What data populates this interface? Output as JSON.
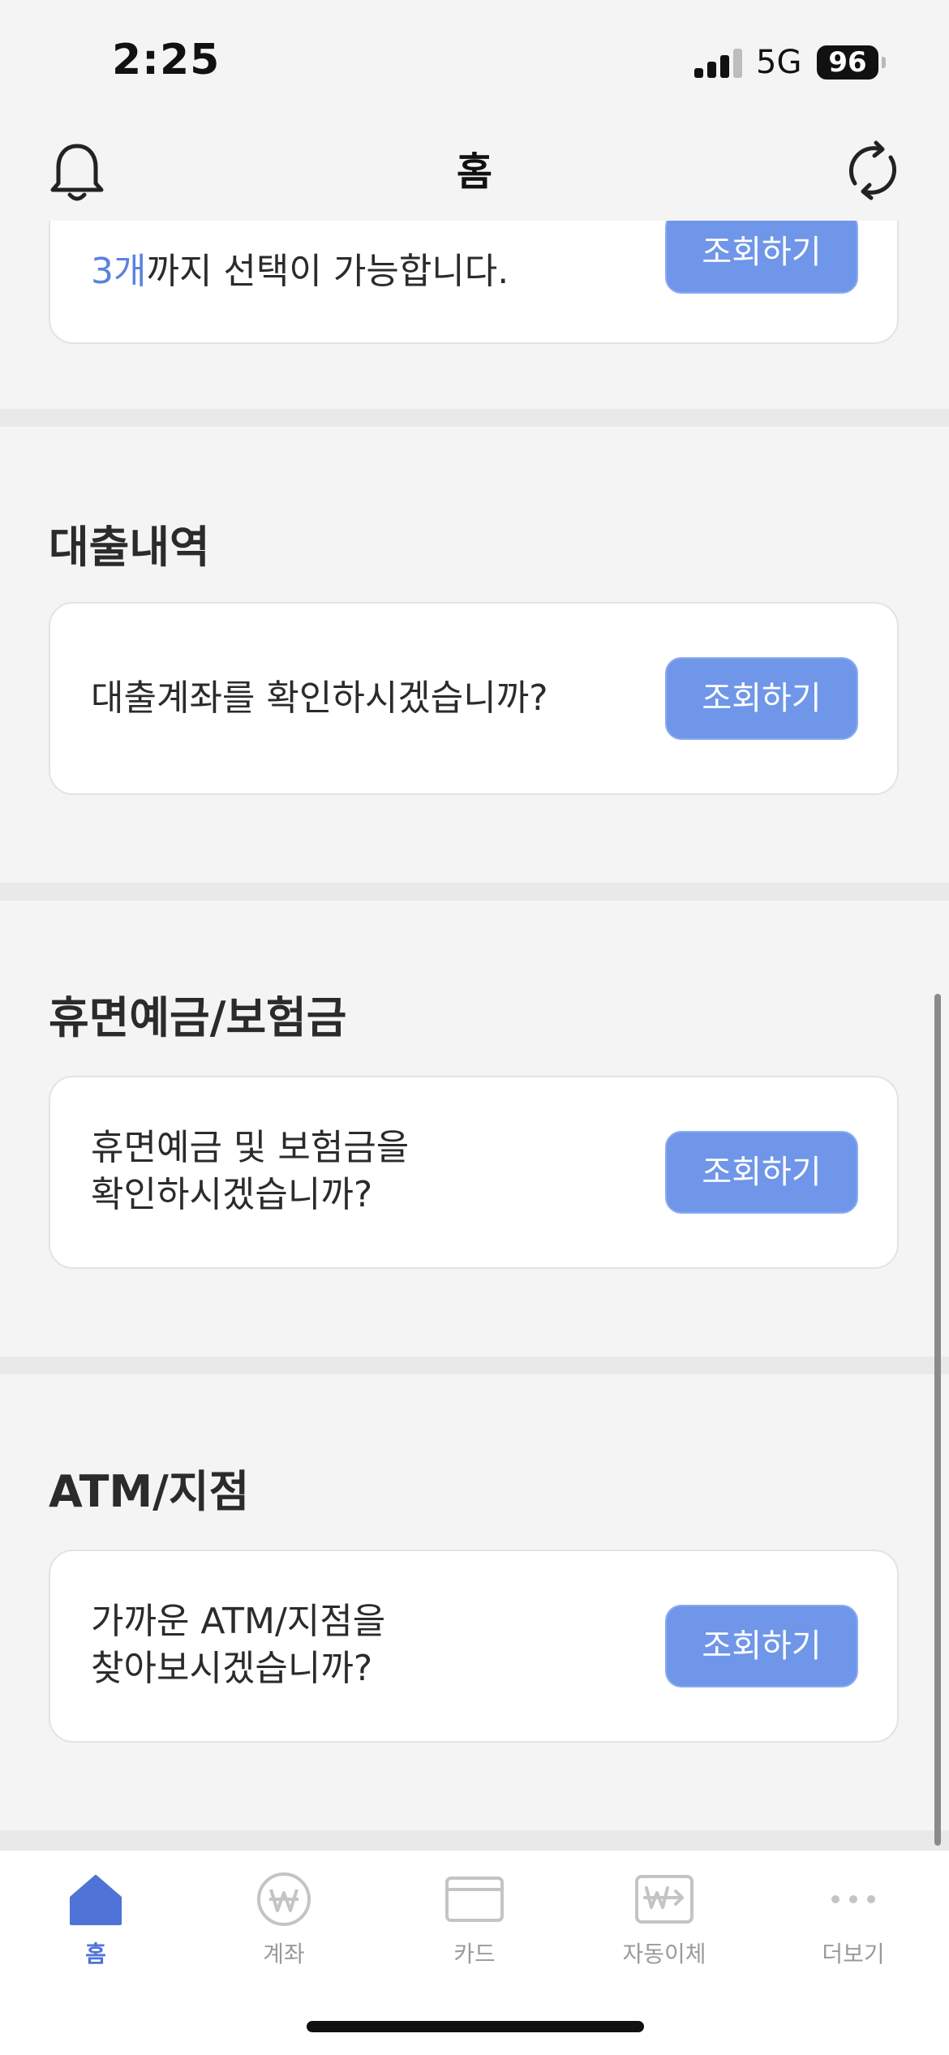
{
  "status_bar": {
    "time": "2:25",
    "network": "5G",
    "battery": "96"
  },
  "header": {
    "title": "홈"
  },
  "sections": {
    "top_card": {
      "highlight": "3개",
      "text": "까지 선택이 가능합니다.",
      "button": "조회하기"
    },
    "loans": {
      "title": "대출내역",
      "text": "대출계좌를 확인하시겠습니까?",
      "button": "조회하기"
    },
    "dormant": {
      "title": "휴면예금/보험금",
      "text_line1": "휴면예금 및 보험금을",
      "text_line2": "확인하시겠습니까?",
      "button": "조회하기"
    },
    "atm": {
      "title": "ATM/지점",
      "text_line1": "가까운 ATM/지점을",
      "text_line2": "찾아보시겠습니까?",
      "button": "조회하기"
    }
  },
  "tabbar": {
    "items": [
      {
        "label": "홈",
        "icon": "home-icon",
        "active": true
      },
      {
        "label": "계좌",
        "icon": "won-coin-icon",
        "active": false
      },
      {
        "label": "카드",
        "icon": "card-icon",
        "active": false
      },
      {
        "label": "자동이체",
        "icon": "auto-transfer-icon",
        "active": false
      },
      {
        "label": "더보기",
        "icon": "more-icon",
        "active": false
      }
    ]
  },
  "colors": {
    "accent": "#5b82e0",
    "button": "#6f96e8",
    "background": "#f4f4f4"
  }
}
